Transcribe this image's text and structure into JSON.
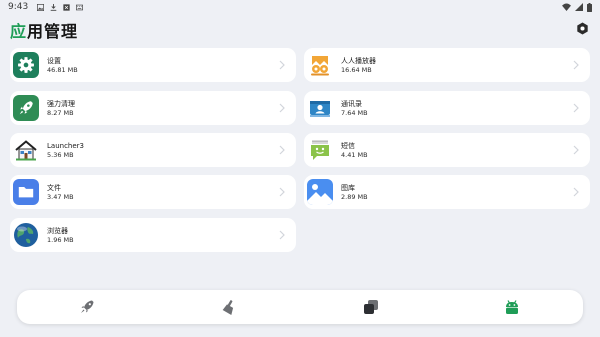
{
  "status_bar": {
    "time": "9:43",
    "left_icons": [
      "image-icon",
      "download-icon",
      "notification-icon",
      "keyboard-icon"
    ],
    "right_icons": [
      "wifi-icon",
      "signal-icon",
      "battery-icon"
    ]
  },
  "header": {
    "title_accent": "应",
    "title_rest": "用管理",
    "accent_color": "#1f9d57",
    "settings_icon": "settings-hexagon-icon"
  },
  "apps_left": [
    {
      "name": "设置",
      "size": "46.81 MB",
      "icon": "settings-gear-icon"
    },
    {
      "name": "强力清理",
      "size": "8.27 MB",
      "icon": "rocket-cleaner-icon"
    },
    {
      "name": "Launcher3",
      "size": "5.36 MB",
      "icon": "house-launcher-icon"
    },
    {
      "name": "文件",
      "size": "3.47 MB",
      "icon": "folder-icon"
    },
    {
      "name": "浏览器",
      "size": "1.96 MB",
      "icon": "globe-browser-icon"
    }
  ],
  "apps_right": [
    {
      "name": "人人播放器",
      "size": "16.64 MB",
      "icon": "player-icon"
    },
    {
      "name": "通讯录",
      "size": "7.64 MB",
      "icon": "contacts-icon"
    },
    {
      "name": "短信",
      "size": "4.41 MB",
      "icon": "messages-icon"
    },
    {
      "name": "图库",
      "size": "2.89 MB",
      "icon": "gallery-icon"
    }
  ],
  "bottom_nav": {
    "items": [
      {
        "icon": "rocket-nav-icon"
      },
      {
        "icon": "broom-nav-icon"
      },
      {
        "icon": "layers-nav-icon"
      },
      {
        "icon": "android-nav-icon",
        "active": true
      }
    ],
    "active_color": "#1f9d57"
  }
}
